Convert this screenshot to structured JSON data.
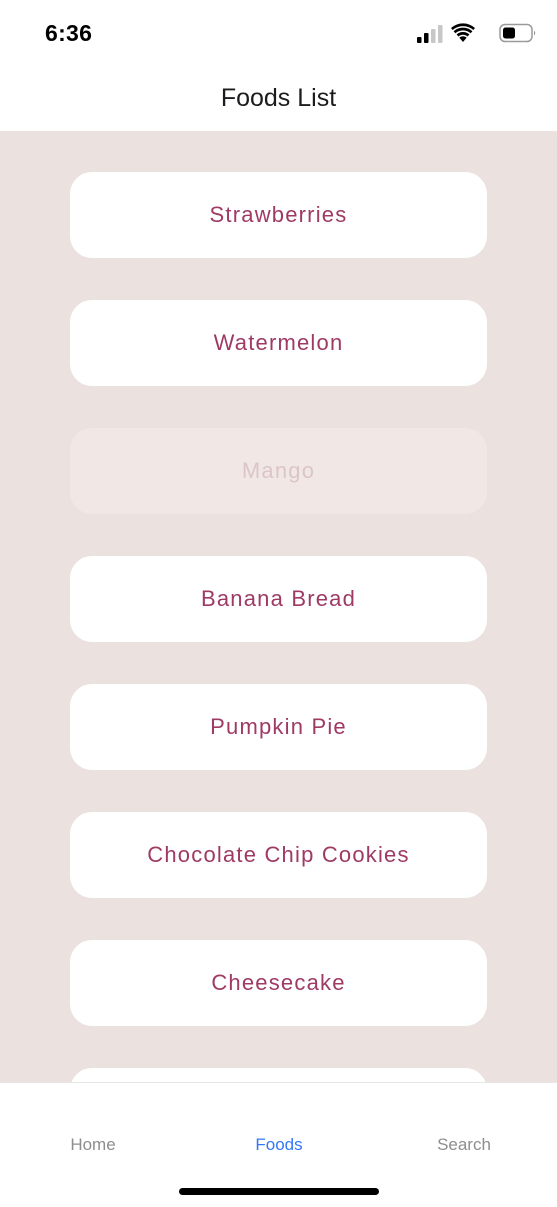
{
  "status_bar": {
    "time": "6:36",
    "icons": [
      "signal-icon",
      "wifi-icon",
      "battery-icon"
    ]
  },
  "header": {
    "title": "Foods List"
  },
  "foods": [
    {
      "label": "Strawberries",
      "state": "normal"
    },
    {
      "label": "Watermelon",
      "state": "normal"
    },
    {
      "label": "Mango",
      "state": "dimmed"
    },
    {
      "label": "Banana Bread",
      "state": "normal"
    },
    {
      "label": "Pumpkin Pie",
      "state": "normal"
    },
    {
      "label": "Chocolate Chip Cookies",
      "state": "normal"
    },
    {
      "label": "Cheesecake",
      "state": "normal"
    },
    {
      "label": "",
      "state": "normal"
    }
  ],
  "tab_bar": {
    "tabs": [
      {
        "label": "Home",
        "active": false
      },
      {
        "label": "Foods",
        "active": true
      },
      {
        "label": "Search",
        "active": false
      }
    ]
  },
  "colors": {
    "background": "#ebe1de",
    "item_text": "#9e3a64",
    "active_tab": "#3478f6",
    "inactive_tab": "#8e8e8e"
  }
}
